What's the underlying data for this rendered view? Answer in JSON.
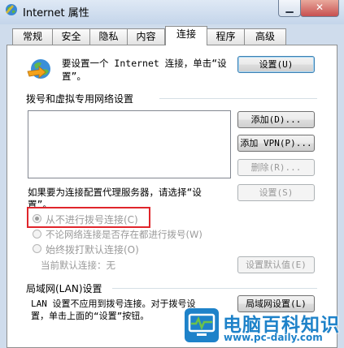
{
  "window": {
    "title": "Internet 属性",
    "minimize_glyph": "▁",
    "close_glyph": "✕"
  },
  "tabs": [
    "常规",
    "安全",
    "隐私",
    "内容",
    "连接",
    "程序",
    "高级"
  ],
  "active_tab": "连接",
  "setup": {
    "text_line1": "要设置一个 Internet 连接，单击“设",
    "text_line2": "置”。",
    "button": "设置(U)"
  },
  "dialup": {
    "section_title": "拨号和虚拟专用网络设置",
    "add_button": "添加(D)...",
    "add_vpn_button": "添加 VPN(P)...",
    "delete_button": "删除(R)...",
    "proxy_text_line1": "如果要为连接配置代理服务器，请选择“设",
    "proxy_text_line2": "置”。",
    "settings_button": "设置(S)",
    "radio_options": [
      {
        "label": "从不进行拨号连接(C)",
        "selected": true
      },
      {
        "label": "不论网络连接是否存在都进行拨号(W)",
        "selected": false
      },
      {
        "label": "始终拨打默认连接(O)",
        "selected": false
      }
    ],
    "default_connection_label": "当前默认连接：无",
    "set_default_button": "设置默认值(E)"
  },
  "lan": {
    "section_title": "局域网(LAN)设置",
    "text_line1": "LAN 设置不应用到拨号连接。对于拨号设",
    "text_line2": "置，单击上面的“设置”按钮。",
    "button": "局域网设置(L)"
  },
  "watermark": {
    "title": "电脑百科知识",
    "url": "www.pc-daily.com"
  },
  "colors": {
    "highlight_box": "#e0252b",
    "watermark_blue": "#1e82c9",
    "watermark_green": "#6cc24a"
  }
}
